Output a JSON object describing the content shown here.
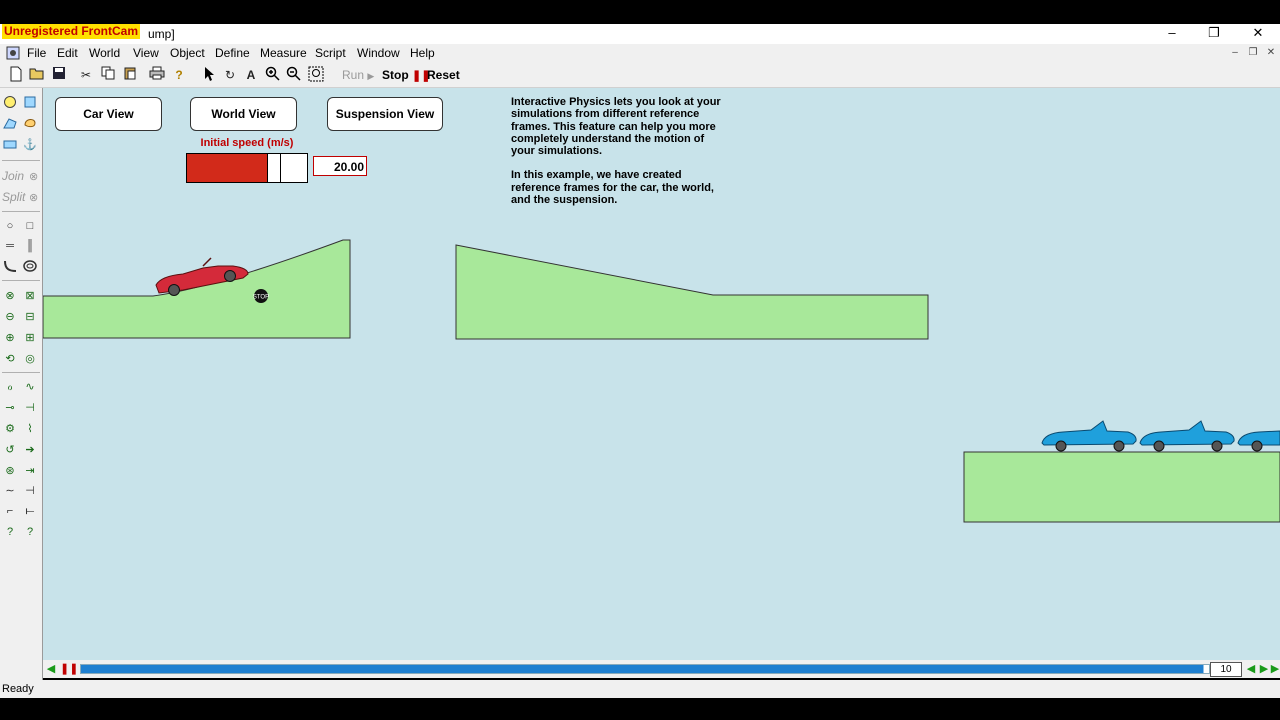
{
  "window": {
    "watermark": "Unregistered FrontCam",
    "title_fragment": "ump]",
    "minimize": "–",
    "restore": "❐",
    "close": "✕"
  },
  "menu": [
    "File",
    "Edit",
    "World",
    "View",
    "Object",
    "Define",
    "Measure",
    "Script",
    "Window",
    "Help"
  ],
  "mdi": {
    "minimize": "–",
    "restore": "❐",
    "close": "✕"
  },
  "toolbar": {
    "run_label": "Run",
    "stop_label": "Stop",
    "reset_label": "Reset"
  },
  "palette": {
    "join_label": "Join",
    "split_label": "Split"
  },
  "view_buttons": {
    "car": "Car View",
    "world": "World View",
    "suspension": "Suspension View"
  },
  "speed": {
    "label": "Initial speed (m/s)",
    "value": "20.00",
    "slider_fraction": 0.78
  },
  "info": {
    "paragraph1": "Interactive Physics lets you look at your simulations from different reference frames. This feature can help you more completely understand the motion of your simulations.",
    "paragraph2": "In this example, we have created reference frames for the car, the world, and the suspension."
  },
  "scene": {
    "stop_sign": "STOP",
    "ground_color": "#a8e89a",
    "car_color": "#d42a3a",
    "ghost_car_color": "#1fa0dc"
  },
  "timeline": {
    "frame": "10",
    "progress": 0.995
  },
  "status": "Ready",
  "colors": {
    "workspace": "#c8e3ea",
    "slider_fill": "#d22a1a"
  }
}
